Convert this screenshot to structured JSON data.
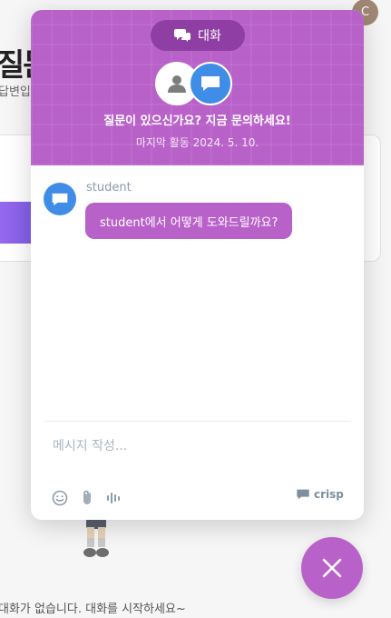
{
  "background": {
    "heading": "질문",
    "subtext": "답변입",
    "empty_message": "대화가 없습니다. 대화를 시작하세요~",
    "user_avatar_initial": "C"
  },
  "chat": {
    "tab_label": "대화",
    "header_title": "질문이 있으신가요? 지금 문의하세요!",
    "header_status": "마지막 활동 2024. 5. 10.",
    "messages": [
      {
        "sender": "student",
        "text": "student에서 어떻게 도와드릴까요?"
      }
    ],
    "compose_placeholder": "메시지 작성...",
    "brand": "crisp"
  },
  "colors": {
    "accent": "#b861c9",
    "accent_dark": "#8f3fa3",
    "operator_blue": "#3f8de6"
  },
  "icons": {
    "tab": "chat-bubbles-icon",
    "operator": "user-icon",
    "brand_avatar": "chat-bubble-icon",
    "emoji": "emoji-icon",
    "attach": "paperclip-icon",
    "audio": "audio-wave-icon",
    "close": "close-icon"
  }
}
